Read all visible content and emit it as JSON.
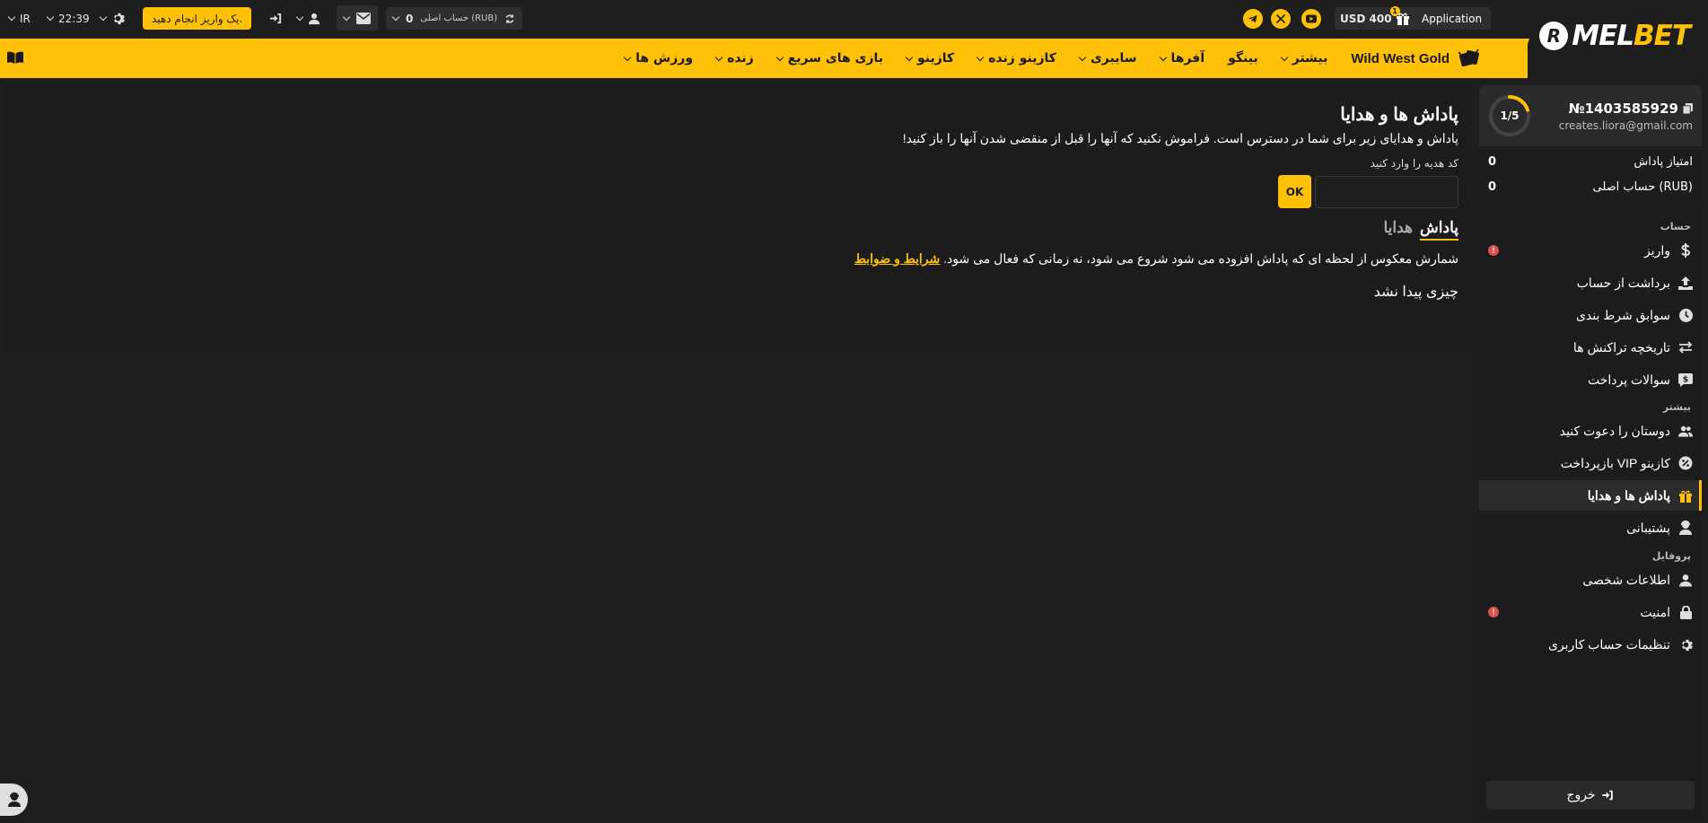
{
  "topbar": {
    "language": "IR",
    "time": "22:39",
    "deposit_button": "یک واریز انجام دهید.",
    "account_label": "حساب اصلی (RUB)",
    "account_balance": "0",
    "bonus_balance": "USD 400",
    "gift_badge": "1",
    "application_button": "Application",
    "logo_mark": "R",
    "logo_mel": "MEL",
    "logo_bet": "BET"
  },
  "nav": {
    "items": [
      {
        "label": "ورزش ها",
        "has_dropdown": true
      },
      {
        "label": "زنده",
        "has_dropdown": true
      },
      {
        "label": "بازی های سریع",
        "has_dropdown": true
      },
      {
        "label": "کازینو",
        "has_dropdown": true
      },
      {
        "label": "کازینو زنده",
        "has_dropdown": true
      },
      {
        "label": "سایبری",
        "has_dropdown": true
      },
      {
        "label": "آفرها",
        "has_dropdown": true
      },
      {
        "label": "بینگو",
        "has_dropdown": false
      },
      {
        "label": "بیشتر",
        "has_dropdown": true
      }
    ],
    "promo": "Wild West Gold"
  },
  "main": {
    "title": "پاداش ها و هدایا",
    "subtitle": "پاداش و هدایای زیر برای شما در دسترس است. فراموش نکنید که آنها را قبل از منقضی شدن آنها را باز کنید!",
    "code_label": "کد هدیه را وارد کنید",
    "code_value": "",
    "ok_button": "OK",
    "tab_bonus": "پاداش",
    "tab_gifts": "هدایا",
    "countdown_text": "شمارش معکوس از لحظه ای که پاداش افزوده می شود شروع می شود، نه زمانی که فعال می شود.",
    "terms_link": "شرایط و ضوابط",
    "empty_text": "چیزی پیدا نشد"
  },
  "sidebar": {
    "progress_label": "1/5",
    "progress_fraction": 0.2,
    "account_number": "№1403585929",
    "email": "creates.liora@gmail.com",
    "bonus_points_label": "امتیاز پاداش",
    "bonus_points_value": "0",
    "main_account_label": "حساب اصلی (RUB)",
    "main_account_value": "0",
    "section_account": "حساب",
    "section_more": "بیشتر",
    "section_profile": "پروفایل",
    "items": {
      "deposit": "واریز",
      "withdraw": "برداشت از حساب",
      "bet_history": "سوابق شرط بندی",
      "transactions": "تاریخچه تراکنش ها",
      "payment_faq": "سوالات پرداخت",
      "invite": "دوستان را دعوت کنید",
      "vip": "بازپرداخت VIP کازینو",
      "bonuses": "پاداش ها و هدایا",
      "support": "پشتیبانی",
      "personal": "اطلاعات شخصی",
      "security": "امنیت",
      "settings": "تنظیمات حساب کاربری"
    },
    "alert_mark": "!",
    "logout": "خروج"
  },
  "colors": {
    "accent": "#ffc107",
    "background": "#1e1e1e",
    "panel": "#2a2a2a",
    "alert": "#d9534f"
  }
}
